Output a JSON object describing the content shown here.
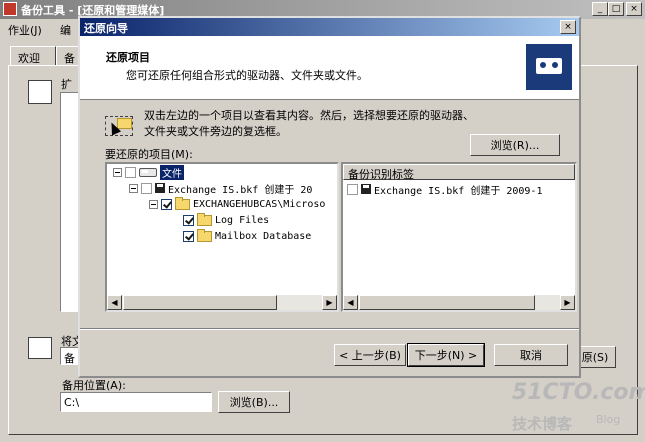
{
  "main_window": {
    "title": "备份工具 - [还原和管理媒体]",
    "menu": [
      "作业(J)",
      "编"
    ],
    "tabs": [
      "欢迎",
      "备"
    ],
    "restore_label_partial": "扩",
    "restore_to_label": "将文",
    "restore_to_value": "备",
    "backup_location_label": "备用位置(A):",
    "backup_location_value": "C:\\",
    "browse_label": "浏览(B)...",
    "right_button_partial": "原(S)"
  },
  "dialog": {
    "title": "还原向导",
    "close_glyph": "×",
    "header_title": "还原项目",
    "header_subtitle": "您可还原任何组合形式的驱动器、文件夹或文件。",
    "instruction": "双击左边的一个项目以查看其内容。然后，选择想要还原的驱动器、文件夹或文件旁边的复选框。",
    "browse_label": "浏览(R)...",
    "items_label": "要还原的项目(M):",
    "tree": [
      {
        "label": "文件",
        "checked": false,
        "icon": "drive-icon",
        "selected": true
      },
      {
        "label": "Exchange IS.bkf 创建于 20",
        "checked": false,
        "icon": "tape-icon"
      },
      {
        "label": "EXCHANGEHUBCAS\\Microso",
        "checked": true,
        "icon": "folder-icon"
      },
      {
        "label": "Log Files",
        "checked": true,
        "icon": "folder-icon"
      },
      {
        "label": "Mailbox Database",
        "checked": true,
        "icon": "folder-icon"
      }
    ],
    "right_pane_header": "备份识别标签",
    "right_pane_items": [
      {
        "label": "Exchange IS.bkf 创建于 2009-1",
        "checked": false
      }
    ],
    "buttons": {
      "back": "< 上一步(B)",
      "next": "下一步(N) >",
      "cancel": "取消"
    }
  },
  "watermark": {
    "line1": "51CTO.com",
    "line2": "技术博客",
    "line3": "Blog"
  }
}
